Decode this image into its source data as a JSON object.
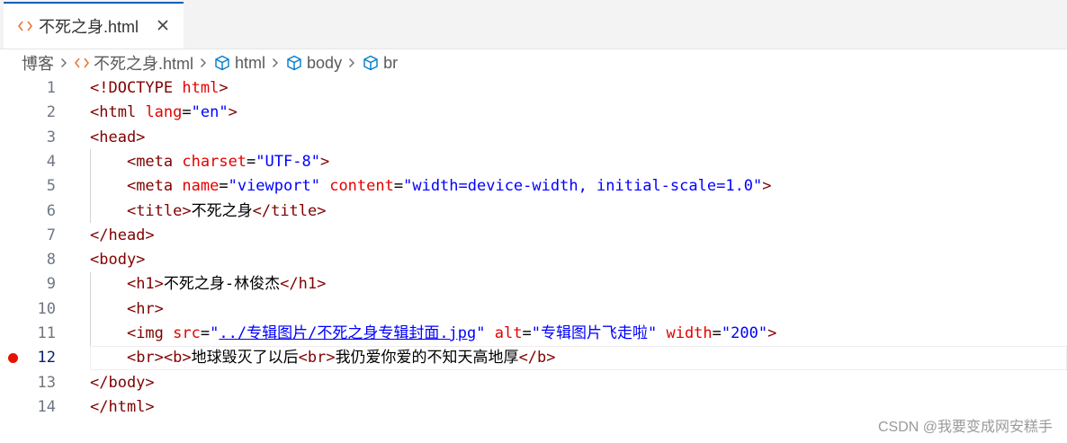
{
  "tab": {
    "title": "不死之身.html",
    "icon": "html-file-icon",
    "close": "close-icon"
  },
  "breadcrumb": {
    "folder": "博客",
    "file": "不死之身.html",
    "symbols": [
      "html",
      "body",
      "br"
    ]
  },
  "editor": {
    "active_line": 12,
    "breakpoint_line": 12,
    "lines": [
      {
        "n": "1",
        "indent": "",
        "tokens": [
          [
            "t",
            "<!DOCTYPE"
          ],
          [
            "p",
            " "
          ],
          [
            "a",
            "html"
          ],
          [
            "t",
            ">"
          ]
        ]
      },
      {
        "n": "2",
        "indent": "",
        "tokens": [
          [
            "t",
            "<html"
          ],
          [
            "p",
            " "
          ],
          [
            "a",
            "lang"
          ],
          [
            "p",
            "="
          ],
          [
            "v",
            "\"en\""
          ],
          [
            "t",
            ">"
          ]
        ]
      },
      {
        "n": "3",
        "indent": "",
        "tokens": [
          [
            "t",
            "<head>"
          ]
        ]
      },
      {
        "n": "4",
        "indent": "    ",
        "tokens": [
          [
            "t",
            "<meta"
          ],
          [
            "p",
            " "
          ],
          [
            "a",
            "charset"
          ],
          [
            "p",
            "="
          ],
          [
            "v",
            "\"UTF-8\""
          ],
          [
            "t",
            ">"
          ]
        ]
      },
      {
        "n": "5",
        "indent": "    ",
        "tokens": [
          [
            "t",
            "<meta"
          ],
          [
            "p",
            " "
          ],
          [
            "a",
            "name"
          ],
          [
            "p",
            "="
          ],
          [
            "v",
            "\"viewport\""
          ],
          [
            "p",
            " "
          ],
          [
            "a",
            "content"
          ],
          [
            "p",
            "="
          ],
          [
            "v",
            "\"width=device-width, initial-scale=1.0\""
          ],
          [
            "t",
            ">"
          ]
        ]
      },
      {
        "n": "6",
        "indent": "    ",
        "tokens": [
          [
            "t",
            "<title>"
          ],
          [
            "p",
            "不死之身"
          ],
          [
            "t",
            "</title>"
          ]
        ]
      },
      {
        "n": "7",
        "indent": "",
        "tokens": [
          [
            "t",
            "</head>"
          ]
        ]
      },
      {
        "n": "8",
        "indent": "",
        "tokens": [
          [
            "t",
            "<body>"
          ]
        ]
      },
      {
        "n": "9",
        "indent": "    ",
        "tokens": [
          [
            "t",
            "<h1>"
          ],
          [
            "p",
            "不死之身-林俊杰"
          ],
          [
            "t",
            "</h1>"
          ]
        ]
      },
      {
        "n": "10",
        "indent": "    ",
        "tokens": [
          [
            "t",
            "<hr>"
          ]
        ]
      },
      {
        "n": "11",
        "indent": "    ",
        "tokens": [
          [
            "t",
            "<img"
          ],
          [
            "p",
            " "
          ],
          [
            "a",
            "src"
          ],
          [
            "p",
            "="
          ],
          [
            "v",
            "\""
          ],
          [
            "vu",
            "../专辑图片/不死之身专辑封面.jpg"
          ],
          [
            "v",
            "\""
          ],
          [
            "p",
            " "
          ],
          [
            "a",
            "alt"
          ],
          [
            "p",
            "="
          ],
          [
            "v",
            "\"专辑图片飞走啦\""
          ],
          [
            "p",
            " "
          ],
          [
            "a",
            "width"
          ],
          [
            "p",
            "="
          ],
          [
            "v",
            "\"200\""
          ],
          [
            "t",
            ">"
          ]
        ]
      },
      {
        "n": "12",
        "indent": "    ",
        "tokens": [
          [
            "t",
            "<br><b>"
          ],
          [
            "p",
            "地球毁灭了以后"
          ],
          [
            "t",
            "<br>"
          ],
          [
            "p",
            "我仍爱你爱的不知天高地厚"
          ],
          [
            "t",
            "</b>"
          ]
        ]
      },
      {
        "n": "13",
        "indent": "",
        "tokens": [
          [
            "t",
            "</body>"
          ]
        ]
      },
      {
        "n": "14",
        "indent": "",
        "tokens": [
          [
            "t",
            "</html>"
          ]
        ]
      }
    ]
  },
  "watermark": "CSDN @我要变成网安糕手",
  "colors": {
    "tag": "#800000",
    "attr": "#e50000",
    "value": "#0000ff",
    "breakpoint": "#e51400",
    "tab_accent": "#005fb8"
  }
}
